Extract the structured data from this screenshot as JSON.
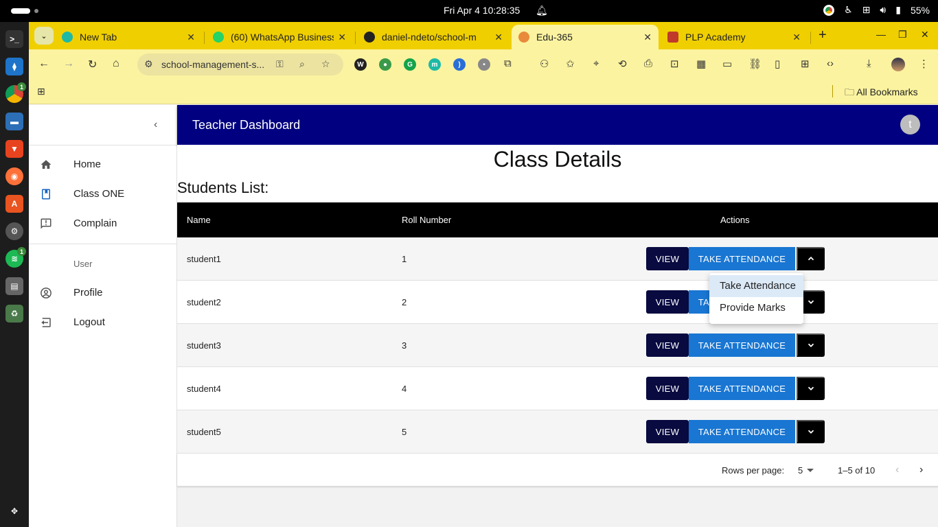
{
  "os": {
    "clock": "Fri Apr 4  10:28:35",
    "battery": "55%"
  },
  "dock": {
    "badges": [
      "1",
      "1"
    ]
  },
  "browser": {
    "tabs": [
      {
        "title": "New Tab",
        "favicon_color": "#1db9a6"
      },
      {
        "title": "(60) WhatsApp Business",
        "favicon_color": "#25d366"
      },
      {
        "title": "daniel-ndeto/school-m",
        "favicon_color": "#222222"
      },
      {
        "title": "Edu-365",
        "favicon_color": "#e88a3a",
        "active": true
      },
      {
        "title": "PLP Academy",
        "favicon_color": "#c0392b"
      }
    ],
    "address": "school-management-s...",
    "bookmarks_label": "All Bookmarks",
    "accent": "#f0cf00"
  },
  "sidebar": {
    "nav": [
      {
        "label": "Home",
        "icon": "home-icon"
      },
      {
        "label": "Class ONE",
        "icon": "class-icon"
      },
      {
        "label": "Complain",
        "icon": "complain-icon"
      }
    ],
    "user_heading": "User",
    "user_nav": [
      {
        "label": "Profile",
        "icon": "profile-icon"
      },
      {
        "label": "Logout",
        "icon": "logout-icon"
      }
    ]
  },
  "header": {
    "title": "Teacher Dashboard",
    "avatar_letter": "t",
    "color": "#000080"
  },
  "main": {
    "title": "Class Details",
    "list_label": "Students List:",
    "columns": [
      "Name",
      "Roll Number",
      "Actions"
    ],
    "rows": [
      {
        "name": "student1",
        "roll": "1"
      },
      {
        "name": "student2",
        "roll": "2"
      },
      {
        "name": "student3",
        "roll": "3"
      },
      {
        "name": "student4",
        "roll": "4"
      },
      {
        "name": "student5",
        "roll": "5"
      }
    ],
    "view_label": "VIEW",
    "attendance_label": "TAKE ATTENDANCE",
    "menu_options": [
      "Take Attendance",
      "Provide Marks"
    ],
    "pagination": {
      "rows_per_page_label": "Rows per page:",
      "rows_per_page": "5",
      "range": "1–5 of 10"
    }
  }
}
